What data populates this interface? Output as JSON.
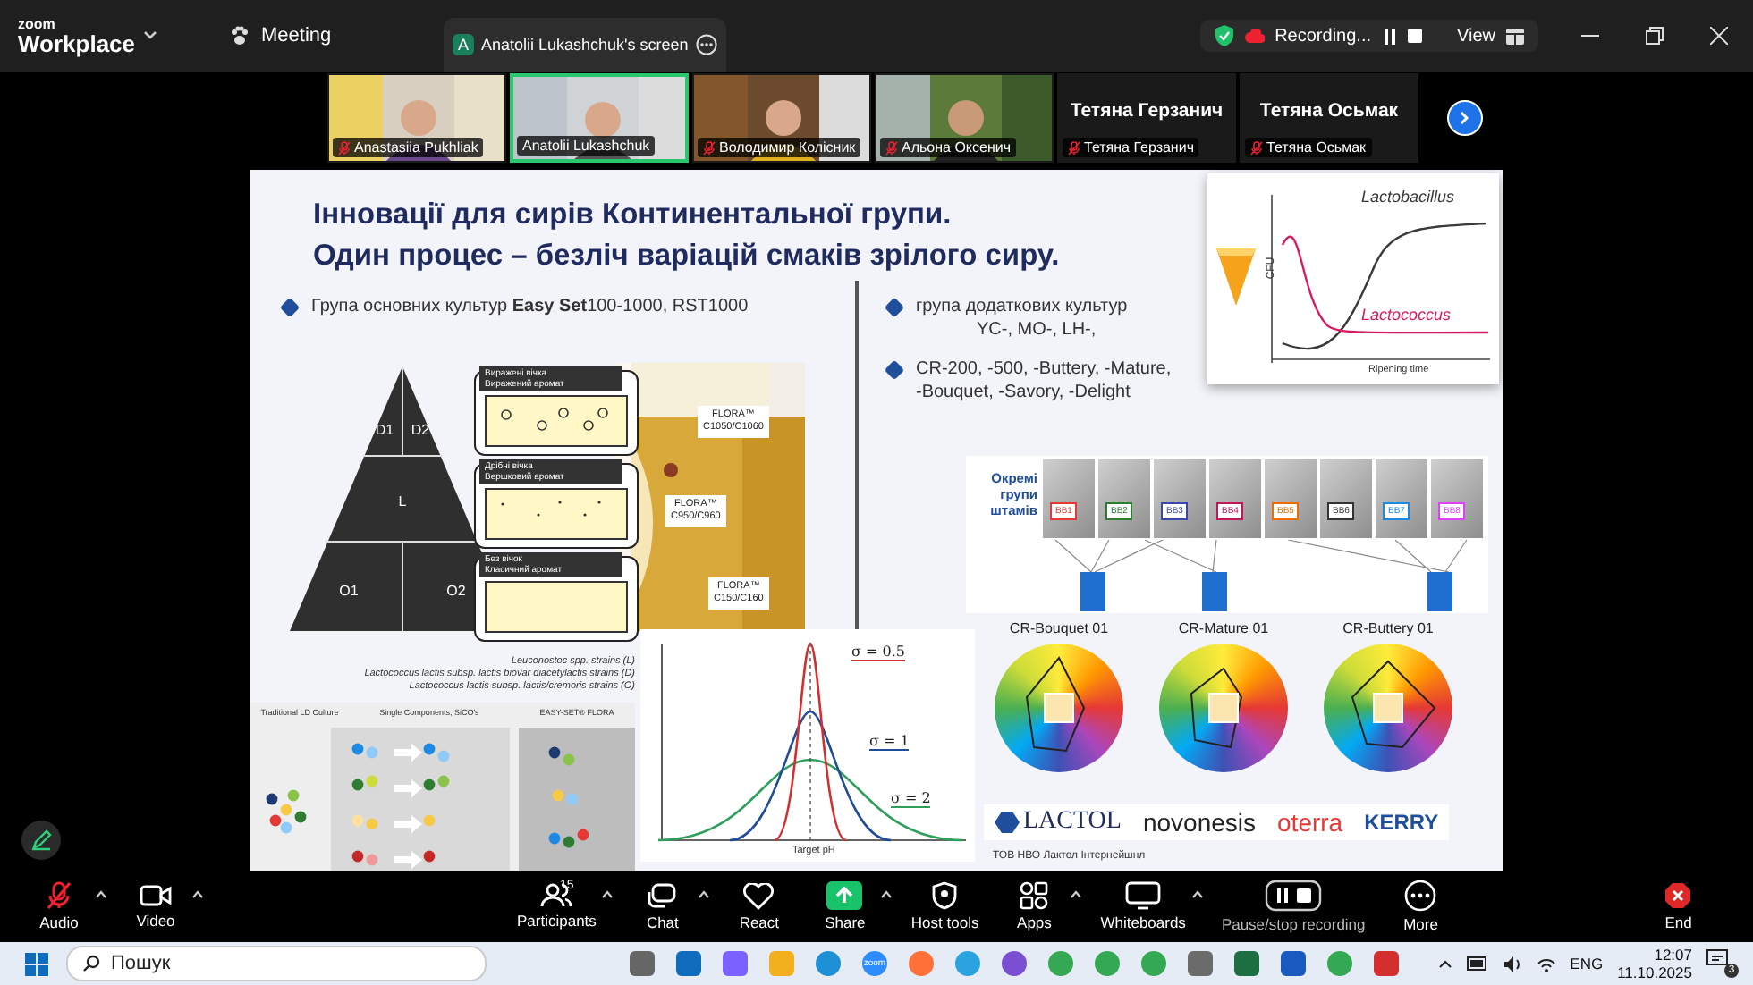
{
  "app": {
    "brand_top": "zoom",
    "brand": "Workplace",
    "meeting": "Meeting",
    "share_tab": {
      "avatar": "A",
      "title": "Anatolii Lukashchuk's screen"
    },
    "recording": "Recording...",
    "view": "View"
  },
  "participants": [
    {
      "kind": "video",
      "name": "Anastasiia Pukhliak",
      "muted": true,
      "active": false
    },
    {
      "kind": "video",
      "name": "Anatolii Lukashchuk",
      "muted": false,
      "active": true
    },
    {
      "kind": "video",
      "name": "Володимир Колісник",
      "muted": true,
      "active": false
    },
    {
      "kind": "video",
      "name": "Альона Оксенич",
      "muted": true,
      "active": false
    },
    {
      "kind": "name",
      "display": "Тетяна Герзанич",
      "name": "Тетяна Герзанич",
      "muted": true,
      "active": false
    },
    {
      "kind": "name",
      "display": "Тетяна Осьмак",
      "name": "Тетяна Осьмак",
      "muted": true,
      "active": false
    }
  ],
  "slide": {
    "title": [
      "Інновації для сирів Континентальної групи.",
      "Один процес – безліч варіацій смаків зрілого сиру."
    ],
    "left_bullet": "Група основних культур **Easy Set**100-1000, RST1000",
    "right_bullets": [
      [
        "група додаткових культур",
        "YC-, MO-, LH-,"
      ],
      [
        "CR-200, -500, -Buttery, -Mature,",
        "-Bouquet, -Savory, -Delight"
      ]
    ],
    "pyramid": {
      "labels": [
        "D1",
        "D2",
        "L",
        "O1",
        "O2"
      ],
      "boxes": [
        {
          "kind": "large",
          "lines": [
            "Виражені вічка",
            "Виражений аромат"
          ]
        },
        {
          "kind": "small",
          "lines": [
            "Дрібні вічка",
            "Вершковий аромат"
          ]
        },
        {
          "kind": "none",
          "lines": [
            "Без вічок",
            "Класичний аромат"
          ]
        }
      ],
      "flora": [
        [
          "FLORA™",
          "C1050/C1060"
        ],
        [
          "FLORA™",
          "C950/C960"
        ],
        [
          "FLORA™",
          "C150/C160"
        ]
      ],
      "legend": [
        "Leuconostoc spp. strains (L)",
        "Lactococcus lactis subsp. lactis biovar diacetylactis strains (D)",
        "Lactococcus lactis subsp. lactis/cremoris strains (O)"
      ]
    },
    "cfu": {
      "ylabel": "CFU",
      "xlabel": "Ripening time",
      "series": [
        {
          "name": "Lactobacillus",
          "color": "#3a3a3a"
        },
        {
          "name": "Lactococcus",
          "color": "#d81b60"
        }
      ]
    },
    "infographic": [
      "Traditional LD Culture",
      "Single Components, SiCO's",
      "EASY-SET® FLORA"
    ],
    "normal": {
      "xlabel": "Target pH",
      "curves": [
        {
          "label": "σ = 0.5",
          "color": "#d32f2f"
        },
        {
          "label": "σ = 1",
          "color": "#1e4b9a"
        },
        {
          "label": "σ = 2",
          "color": "#2e9e5b"
        }
      ]
    },
    "strains": {
      "heading": [
        "Окремі",
        "групи",
        "штамів"
      ],
      "cartons": [
        {
          "label": "BB1",
          "color": "#e53935"
        },
        {
          "label": "BB2",
          "color": "#2e7d32"
        },
        {
          "label": "BB3",
          "color": "#3949ab"
        },
        {
          "label": "BB4",
          "color": "#c2185b"
        },
        {
          "label": "BB5",
          "color": "#ef6c00"
        },
        {
          "label": "BB6",
          "color": "#333333"
        },
        {
          "label": "BB7",
          "color": "#1e88e5"
        },
        {
          "label": "BB8",
          "color": "#e040fb"
        }
      ]
    },
    "wheels": [
      "CR-Bouquet 01",
      "CR-Mature 01",
      "CR-Buttery 01"
    ],
    "logos": [
      "LACTOL",
      "novonesis",
      "oterra",
      "KERRY"
    ],
    "caption": "ТОВ НВО Лактол Інтернейшнл"
  },
  "toolbar": [
    {
      "kind": "audio",
      "label": "Audio",
      "muted": true
    },
    {
      "kind": "video",
      "label": "Video"
    },
    {
      "kind": "participants",
      "label": "Participants",
      "count": "15"
    },
    {
      "kind": "chat",
      "label": "Chat"
    },
    {
      "kind": "react",
      "label": "React"
    },
    {
      "kind": "share",
      "label": "Share"
    },
    {
      "kind": "host",
      "label": "Host tools"
    },
    {
      "kind": "apps",
      "label": "Apps"
    },
    {
      "kind": "whiteboards",
      "label": "Whiteboards"
    },
    {
      "kind": "recording",
      "label": "Pause/stop recording"
    },
    {
      "kind": "more",
      "label": "More"
    },
    {
      "kind": "end",
      "label": "End"
    }
  ],
  "taskbar": {
    "search": "Пошук",
    "apps": [
      {
        "kind": "taskview"
      },
      {
        "kind": "outlook"
      },
      {
        "kind": "copilot"
      },
      {
        "kind": "files"
      },
      {
        "kind": "edge"
      },
      {
        "kind": "zoom",
        "label": "zoom"
      },
      {
        "kind": "firefox"
      },
      {
        "kind": "telegram"
      },
      {
        "kind": "viber"
      },
      {
        "kind": "chrome"
      },
      {
        "kind": "chrome"
      },
      {
        "kind": "chrome"
      },
      {
        "kind": "settings"
      },
      {
        "kind": "excel"
      },
      {
        "kind": "word"
      },
      {
        "kind": "chrome"
      },
      {
        "kind": "pdf"
      }
    ],
    "language": "ENG",
    "time": "12:07",
    "date": "11.10.2025",
    "notifications": "3"
  }
}
